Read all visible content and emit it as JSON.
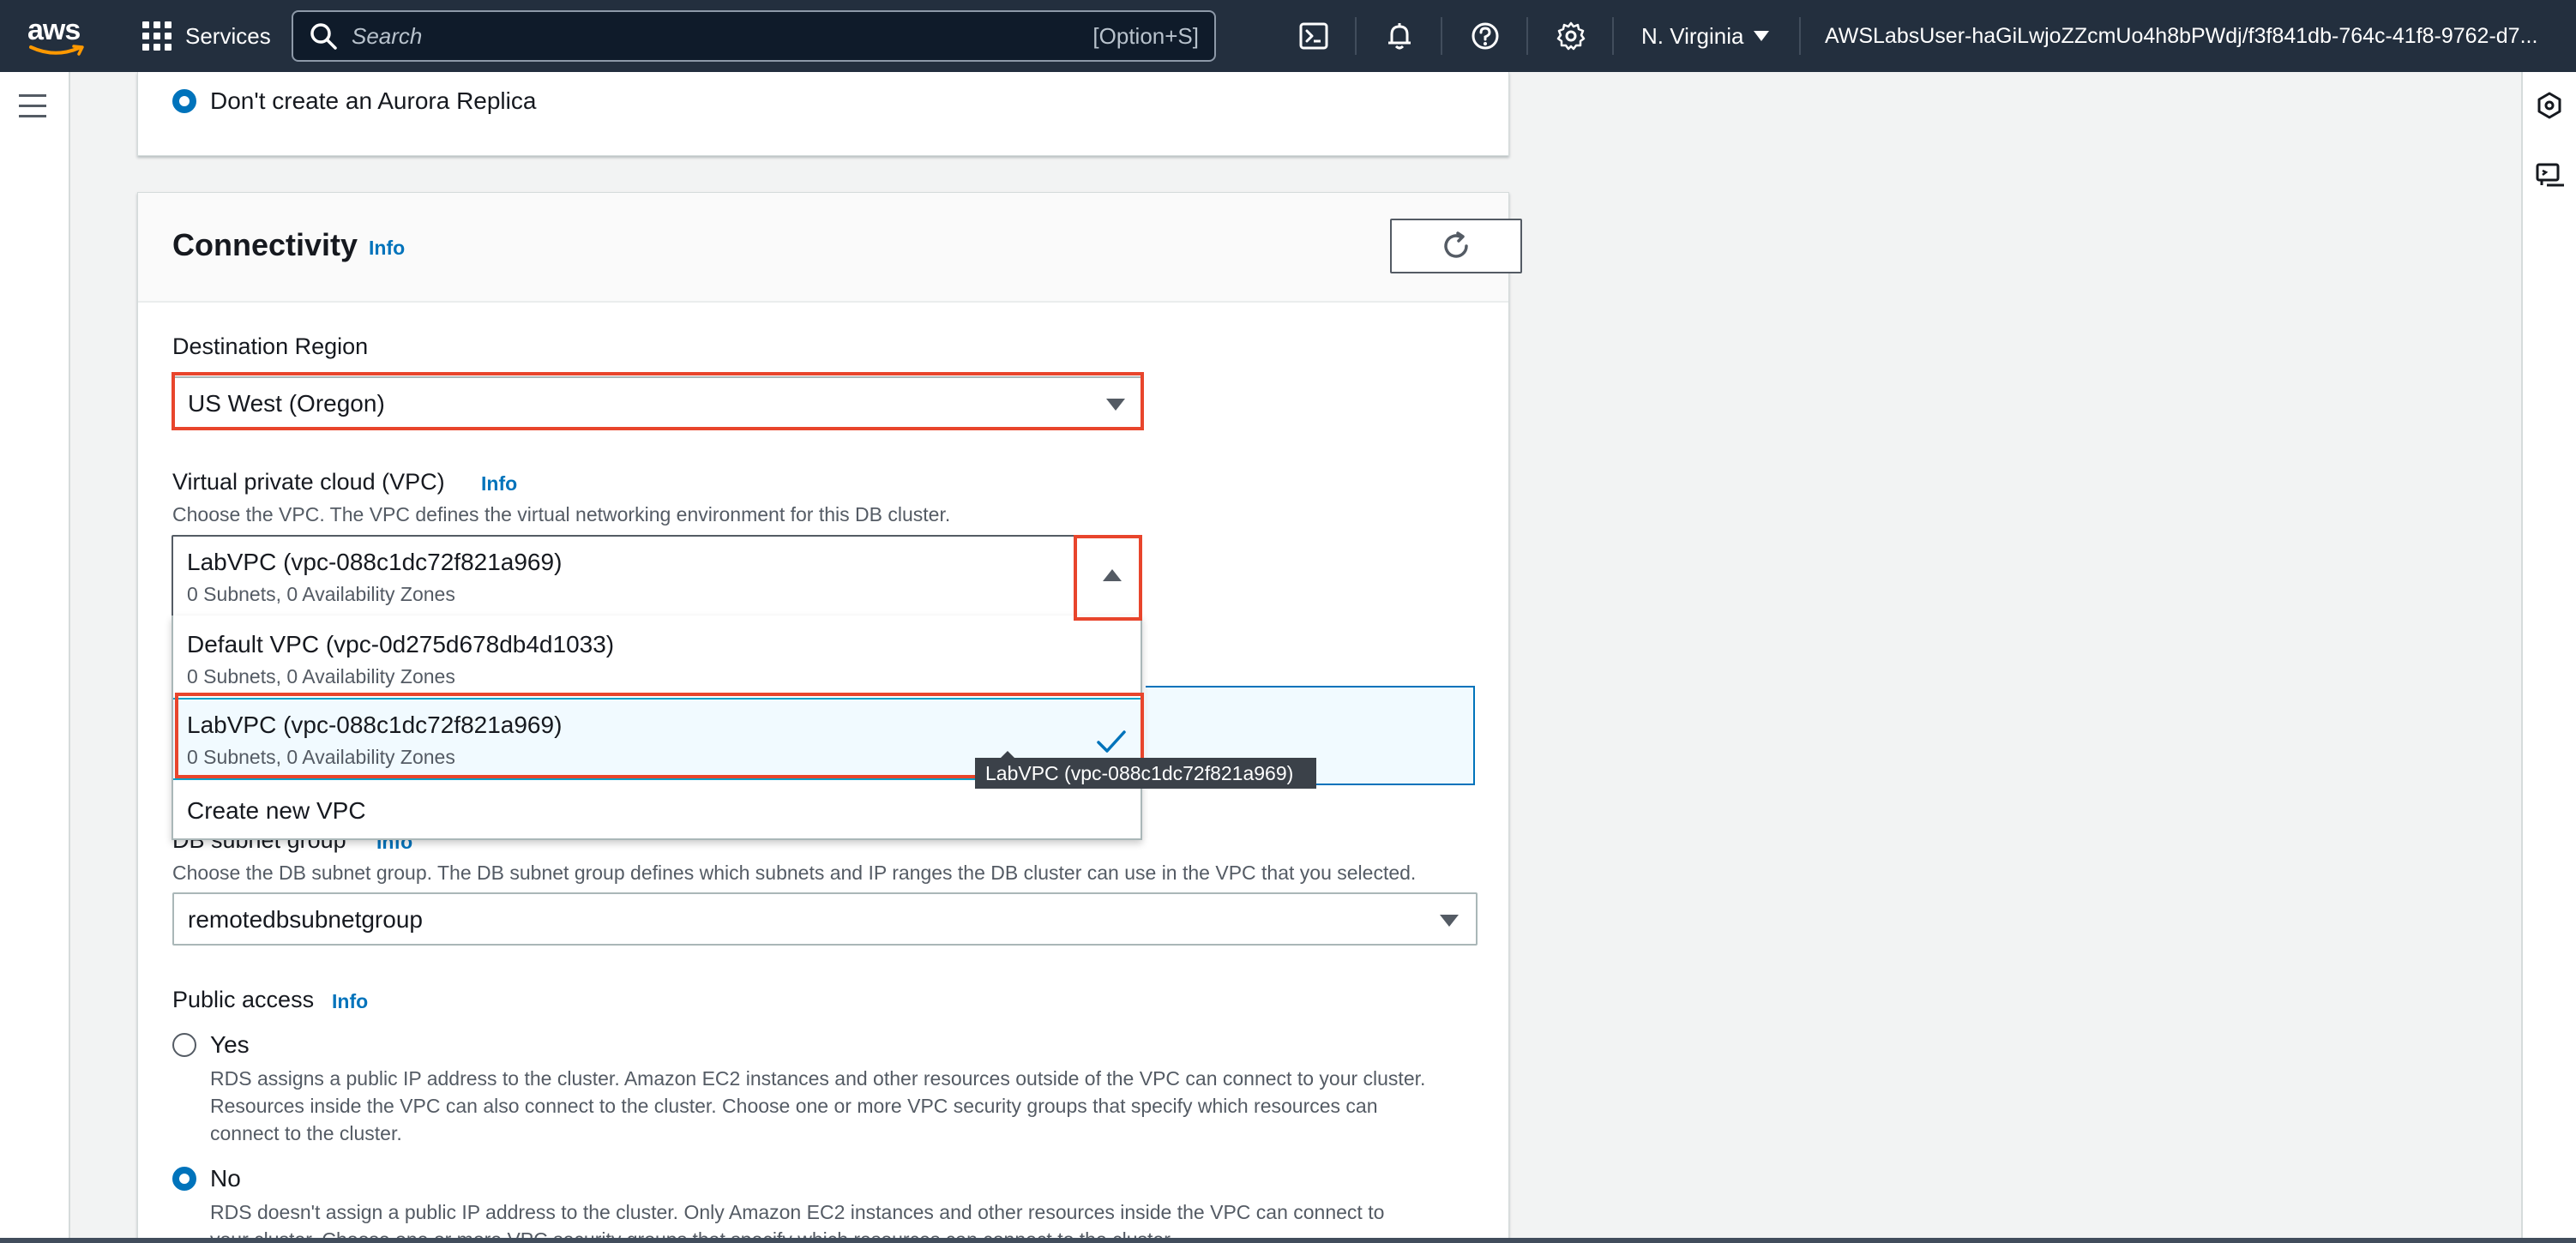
{
  "topnav": {
    "logo_text": "aws",
    "services_label": "Services",
    "search_placeholder": "Search",
    "search_shortcut": "[Option+S]",
    "icons": [
      "cloudshell-icon",
      "bell-icon",
      "help-icon",
      "gear-icon"
    ],
    "region": "N. Virginia",
    "account": "AWSLabsUser-haGiLwjoZZcmUo4h8bPWdj/f3f841db-764c-41f8-9762-d7..."
  },
  "replica": {
    "option_label": "Don't create an Aurora Replica"
  },
  "connectivity": {
    "title": "Connectivity",
    "info": "Info",
    "destination_region": {
      "label": "Destination Region",
      "value": "US West (Oregon)"
    },
    "vpc": {
      "label": "Virtual private cloud (VPC)",
      "info": "Info",
      "description": "Choose the VPC. The VPC defines the virtual networking environment for this DB cluster.",
      "value": "LabVPC (vpc-088c1dc72f821a969)",
      "value_sub": "0 Subnets, 0 Availability Zones",
      "options": [
        {
          "label": "Default VPC (vpc-0d275d678db4d1033)",
          "sub": "0 Subnets, 0 Availability Zones"
        },
        {
          "label": "LabVPC (vpc-088c1dc72f821a969)",
          "sub": "0 Subnets, 0 Availability Zones",
          "selected": true
        },
        {
          "label": "Create new VPC"
        }
      ],
      "tooltip": "LabVPC (vpc-088c1dc72f821a969)"
    },
    "subnet_group": {
      "label": "DB subnet group",
      "info": "Info",
      "description": "Choose the DB subnet group. The DB subnet group defines which subnets and IP ranges the DB cluster can use in the VPC that you selected.",
      "value": "remotedbsubnetgroup"
    },
    "public_access": {
      "label": "Public access",
      "info": "Info",
      "yes": {
        "label": "Yes",
        "line1": "RDS assigns a public IP address to the cluster. Amazon EC2 instances and other resources outside of the VPC can connect to your cluster.",
        "line2": "Resources inside the VPC can also connect to the cluster. Choose one or more VPC security groups that specify which resources can",
        "line3": "connect to the cluster."
      },
      "no": {
        "label": "No",
        "line1": "RDS doesn't assign a public IP address to the cluster. Only Amazon EC2 instances and other resources inside the VPC can connect to",
        "line2": "your cluster. Choose one or more VPC security groups that specify which resources can connect to the cluster."
      }
    }
  },
  "colors": {
    "nav_bg": "#232f3e",
    "accent": "#0073bb",
    "highlight": "#e8452c"
  }
}
